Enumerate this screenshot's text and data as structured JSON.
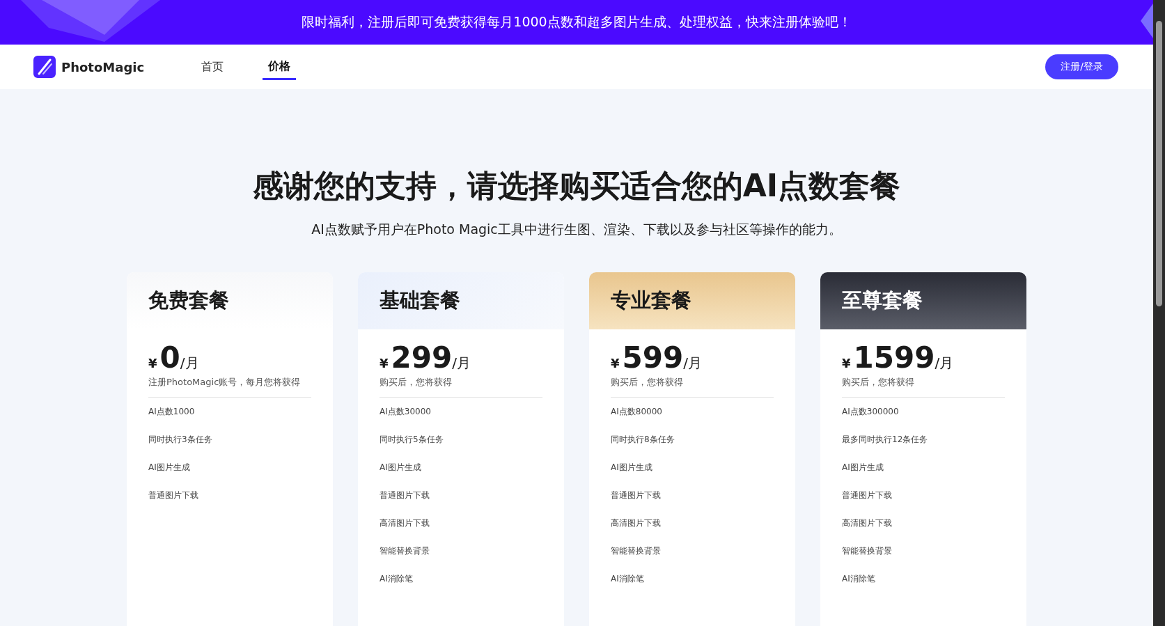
{
  "banner": {
    "text": "限时福利，注册后即可免费获得每月1000点数和超多图片生成、处理权益，快来注册体验吧！"
  },
  "nav": {
    "brand": "PhotoMagic",
    "items": [
      {
        "label": "首页",
        "selected": false
      },
      {
        "label": "价格",
        "selected": true
      }
    ],
    "login_button": "注册/登录"
  },
  "hero": {
    "title": "感谢您的支持，请选择购买适合您的AI点数套餐",
    "subtitle": "AI点数赋予用户在Photo Magic工具中进行生图、渲染、下载以及参与社区等操作的能力。"
  },
  "plans": [
    {
      "kind": "free",
      "name": "免费套餐",
      "currency": "¥",
      "price": "0",
      "unit": "/月",
      "note": "注册PhotoMagic账号，每月您将获得",
      "features": [
        "AI点数1000",
        "同时执行3条任务",
        "AI图片生成",
        "普通图片下载"
      ]
    },
    {
      "kind": "basic",
      "name": "基础套餐",
      "currency": "¥",
      "price": "299",
      "unit": "/月",
      "note": "购买后，您将获得",
      "features": [
        "AI点数30000",
        "同时执行5条任务",
        "AI图片生成",
        "普通图片下载",
        "高清图片下载",
        "智能替换背景",
        "AI消除笔"
      ]
    },
    {
      "kind": "pro",
      "name": "专业套餐",
      "currency": "¥",
      "price": "599",
      "unit": "/月",
      "note": "购买后，您将获得",
      "features": [
        "AI点数80000",
        "同时执行8条任务",
        "AI图片生成",
        "普通图片下载",
        "高清图片下载",
        "智能替换背景",
        "AI消除笔"
      ]
    },
    {
      "kind": "premium",
      "name": "至尊套餐",
      "currency": "¥",
      "price": "1599",
      "unit": "/月",
      "note": "购买后，您将获得",
      "features": [
        "AI点数300000",
        "最多同时执行12条任务",
        "AI图片生成",
        "普通图片下载",
        "高清图片下载",
        "智能替换背景",
        "AI消除笔"
      ]
    }
  ]
}
